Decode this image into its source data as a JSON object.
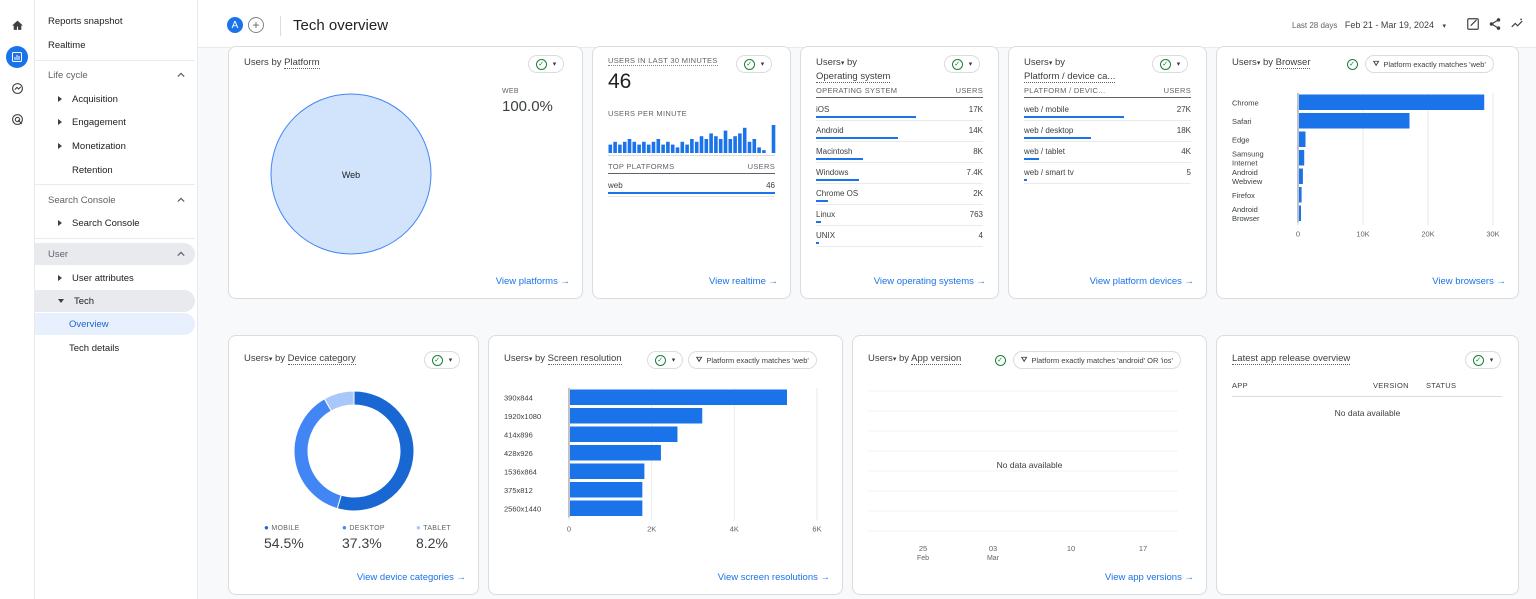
{
  "header": {
    "avatar_letter": "A",
    "plus": "+",
    "title": "Tech overview",
    "date_label": "Last 28 days",
    "date_range": "Feb 21 - Mar 19, 2024"
  },
  "nav": {
    "reports_snapshot": "Reports snapshot",
    "realtime": "Realtime",
    "lifecycle": "Life cycle",
    "acquisition": "Acquisition",
    "engagement": "Engagement",
    "monetization": "Monetization",
    "retention": "Retention",
    "search_console_section": "Search Console",
    "search_console": "Search Console",
    "user_section": "User",
    "user_attributes": "User attributes",
    "tech": "Tech",
    "overview": "Overview",
    "tech_details": "Tech details"
  },
  "platform_card": {
    "title_prefix": "Users by ",
    "title_dim": "Platform",
    "legend_label": "WEB",
    "legend_value": "100.0%",
    "slice_label": "Web",
    "link": "View platforms"
  },
  "realtime_card": {
    "title": "USERS IN LAST 30 MINUTES",
    "count": "46",
    "per_minute": "USERS PER MINUTE",
    "per_minute_values": [
      3,
      4,
      3,
      4,
      5,
      4,
      3,
      4,
      3,
      4,
      5,
      3,
      4,
      3,
      2,
      4,
      3,
      5,
      4,
      6,
      5,
      7,
      6,
      5,
      8,
      5,
      6,
      7,
      9,
      4,
      5,
      2,
      1,
      0,
      10
    ],
    "col1": "TOP PLATFORMS",
    "col2": "USERS",
    "row_key": "web",
    "row_val": "46",
    "link": "View realtime"
  },
  "os_card": {
    "title_prefix": "Users",
    "title_mid": " by",
    "title_dim": "Operating system",
    "col1": "OPERATING SYSTEM",
    "col2": "USERS",
    "rows": [
      {
        "k": "iOS",
        "v": "17K",
        "f": 1.0
      },
      {
        "k": "Android",
        "v": "14K",
        "f": 0.82
      },
      {
        "k": "Macintosh",
        "v": "8K",
        "f": 0.47
      },
      {
        "k": "Windows",
        "v": "7.4K",
        "f": 0.43
      },
      {
        "k": "Chrome OS",
        "v": "2K",
        "f": 0.12
      },
      {
        "k": "Linux",
        "v": "763",
        "f": 0.045
      },
      {
        "k": "UNIX",
        "v": "4",
        "f": 0.0
      }
    ],
    "link": "View operating systems"
  },
  "device_card": {
    "title_prefix": "Users",
    "title_mid": " by",
    "title_dim": "Platform / device ca...",
    "col1": "PLATFORM / DEVIC...",
    "col2": "USERS",
    "rows": [
      {
        "k": "web / mobile",
        "v": "27K",
        "f": 1.0
      },
      {
        "k": "web / desktop",
        "v": "18K",
        "f": 0.67
      },
      {
        "k": "web / tablet",
        "v": "4K",
        "f": 0.15
      },
      {
        "k": "web / smart tv",
        "v": "5",
        "f": 0.0
      }
    ],
    "link": "View platform devices"
  },
  "browser_card": {
    "title_prefix": "Users",
    "title_mid": " by ",
    "title_dim": "Browser",
    "filter": "Platform exactly matches 'web'",
    "link": "View browsers",
    "chart_data": {
      "type": "bar",
      "orientation": "horizontal",
      "categories": [
        "Chrome",
        "Safari",
        "Edge",
        "Samsung Internet",
        "Android Webview",
        "Firefox",
        "Android Browser"
      ],
      "values": [
        28500,
        17000,
        1000,
        800,
        600,
        400,
        200
      ],
      "xlim": [
        0,
        30000
      ],
      "xticks": [
        "0",
        "10K",
        "20K",
        "30K"
      ],
      "color": "#1a73e8"
    }
  },
  "category_card": {
    "title_prefix": "Users",
    "title_mid": " by ",
    "title_dim": "Device category",
    "link": "View device categories",
    "chart_data": {
      "type": "pie",
      "donut": true,
      "categories": [
        "MOBILE",
        "DESKTOP",
        "TABLET"
      ],
      "values": [
        54.5,
        37.3,
        8.2
      ],
      "labels": [
        "54.5%",
        "37.3%",
        "8.2%"
      ],
      "colors": [
        "#1967d2",
        "#4285f4",
        "#a8c7fa"
      ]
    }
  },
  "resolution_card": {
    "title_prefix": "Users",
    "title_mid": " by ",
    "title_dim": "Screen resolution",
    "filter": "Platform exactly matches 'web'",
    "link": "View screen resolutions",
    "chart_data": {
      "type": "bar",
      "orientation": "horizontal",
      "categories": [
        "390x844",
        "1920x1080",
        "414x896",
        "428x926",
        "1536x864",
        "375x812",
        "2560x1440"
      ],
      "values": [
        5250,
        3200,
        2600,
        2200,
        1800,
        1750,
        1750
      ],
      "xlim": [
        0,
        6000
      ],
      "xticks": [
        "0",
        "2K",
        "4K",
        "6K"
      ],
      "color": "#1a73e8"
    }
  },
  "appversion_card": {
    "title_prefix": "Users",
    "title_mid": " by ",
    "title_dim": "App version",
    "filter": "Platform exactly matches 'android' OR 'ios'",
    "empty": "No data available",
    "xticks": [
      [
        "25",
        "Feb"
      ],
      [
        "03",
        "Mar"
      ],
      [
        "10",
        ""
      ],
      [
        "17",
        ""
      ]
    ],
    "link": "View app versions"
  },
  "release_card": {
    "title": "Latest app release overview",
    "col_app": "APP",
    "col_version": "VERSION",
    "col_status": "STATUS",
    "empty": "No data available"
  }
}
